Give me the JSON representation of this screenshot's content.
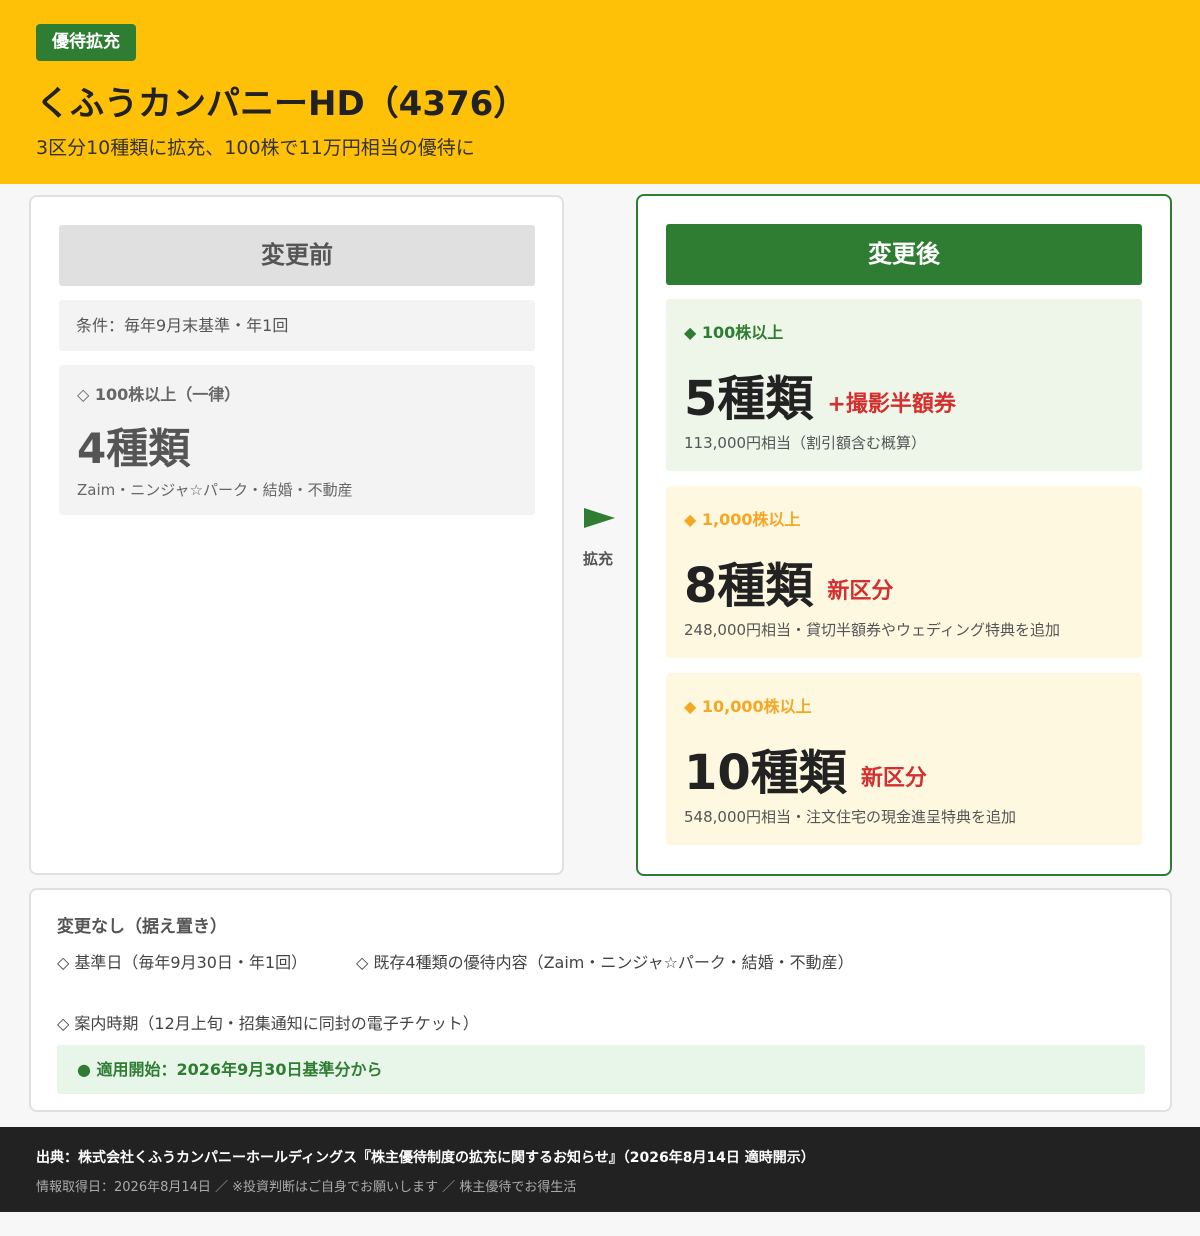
{
  "header": {
    "badge": "優待拡充",
    "title": "くふうカンパニーHD（4376）",
    "subtitle": "3区分10種類に拡充、100株で11万円相当の優待に"
  },
  "before": {
    "heading": "変更前",
    "condition": "条件：毎年9月末基準・年1回",
    "tier": {
      "label": "◇ 100株以上（一律）",
      "value": "4種類",
      "desc": "Zaim・ニンジャ☆パーク・結婚・不動産"
    }
  },
  "arrow": {
    "label": "拡充"
  },
  "after": {
    "heading": "変更後",
    "tiers": [
      {
        "label": "◆ 100株以上",
        "value": "5種類",
        "tag": "+撮影半額券",
        "desc": "113,000円相当（割引額含む概算）"
      },
      {
        "label": "◆ 1,000株以上",
        "value": "8種類",
        "tag": "新区分",
        "desc": "248,000円相当・貸切半額券やウェディング特典を追加"
      },
      {
        "label": "◆ 10,000株以上",
        "value": "10種類",
        "tag": "新区分",
        "desc": "548,000円相当・注文住宅の現金進呈特典を追加"
      }
    ]
  },
  "nochange": {
    "title": "変更なし（据え置き）",
    "items": [
      "◇ 基準日（毎年9月30日・年1回）",
      "◇ 既存4種類の優待内容（Zaim・ニンジャ☆パーク・結婚・不動産）",
      "◇ 案内時期（12月上旬・招集通知に同封の電子チケット）"
    ],
    "start": "● 適用開始：2026年9月30日基準分から"
  },
  "footer": {
    "source": "出典：株式会社くふうカンパニーホールディングス『株主優待制度の拡充に関するお知らせ』（2026年8月14日 適時開示）",
    "meta": "情報取得日：2026年8月14日 ／ ※投資判断はご自身でお願いします ／ 株主優待でお得生活"
  },
  "colors": {
    "header_bg": "#FFC107",
    "brand_green": "#2E7D32",
    "accent_red": "#D32F2F",
    "accent_orange": "#F5A623",
    "footer_bg": "#222222"
  }
}
